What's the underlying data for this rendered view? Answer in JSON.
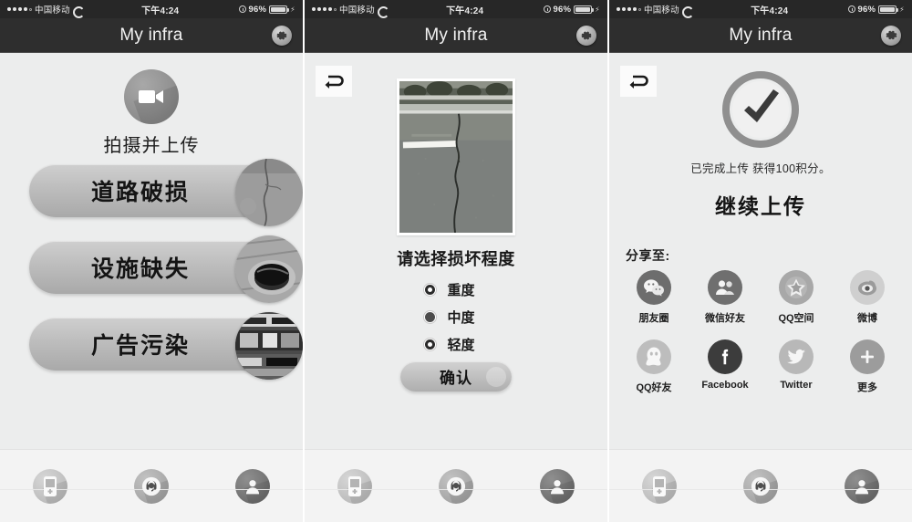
{
  "status_bar": {
    "carrier": "中国移动",
    "signal_filled_dots": 4,
    "signal_empty_dots": 1,
    "wifi_icon": "wifi-icon",
    "time": "下午4:24",
    "alarm_icon": "alarm-icon",
    "battery_percent": "96%",
    "battery_level": 96,
    "charging_icon": "bolt-icon"
  },
  "nav": {
    "title": "My infra",
    "settings_icon": "gear-icon"
  },
  "colors": {
    "navbar_bg": "#2e2e2e",
    "statusbar_bg": "#272727",
    "screen_bg": "#eceded",
    "tabbar_bg": "#f3f3f3",
    "pill_top": "#cfcfcf",
    "pill_bottom": "#a9a9a9",
    "text_primary": "#141414"
  },
  "screen1": {
    "capture": {
      "icon": "video-camera-icon",
      "label": "拍摄并上传"
    },
    "categories": [
      {
        "label": "道路破损",
        "thumb_icon": "road-crack-thumbnail"
      },
      {
        "label": "设施缺失",
        "thumb_icon": "manhole-thumbnail"
      },
      {
        "label": "广告污染",
        "thumb_icon": "billboard-thumbnail"
      }
    ]
  },
  "screen2": {
    "back_icon": "back-arrow-icon",
    "photo": {
      "alt": "road-crack-photo"
    },
    "question": "请选择损坏程度",
    "options": [
      {
        "label": "重度",
        "state": "ring"
      },
      {
        "label": "中度",
        "state": "solid"
      },
      {
        "label": "轻度",
        "state": "ring"
      }
    ],
    "confirm_label": "确认"
  },
  "screen3": {
    "back_icon": "back-arrow-icon",
    "success_icon": "check-circle-icon",
    "done_text": "已完成上传  获得100积分。",
    "continue_label": "继续上传",
    "share_title": "分享至:",
    "share_rows": [
      [
        {
          "label": "朋友圈",
          "icon": "wechat-moments-icon"
        },
        {
          "label": "微信好友",
          "icon": "wechat-friends-icon"
        },
        {
          "label": "QQ空间",
          "icon": "qzone-star-icon"
        },
        {
          "label": "微博",
          "icon": "weibo-eye-icon"
        }
      ],
      [
        {
          "label": "QQ好友",
          "icon": "qq-penguin-icon"
        },
        {
          "label": "Facebook",
          "icon": "facebook-icon"
        },
        {
          "label": "Twitter",
          "icon": "twitter-bird-icon"
        },
        {
          "label": "更多",
          "icon": "plus-more-icon"
        }
      ]
    ]
  },
  "tabbar": {
    "items": [
      {
        "icon": "mobile-phone-icon",
        "name": "tab-device"
      },
      {
        "icon": "headset-support-icon",
        "name": "tab-support"
      },
      {
        "icon": "user-profile-icon",
        "name": "tab-profile"
      }
    ]
  }
}
